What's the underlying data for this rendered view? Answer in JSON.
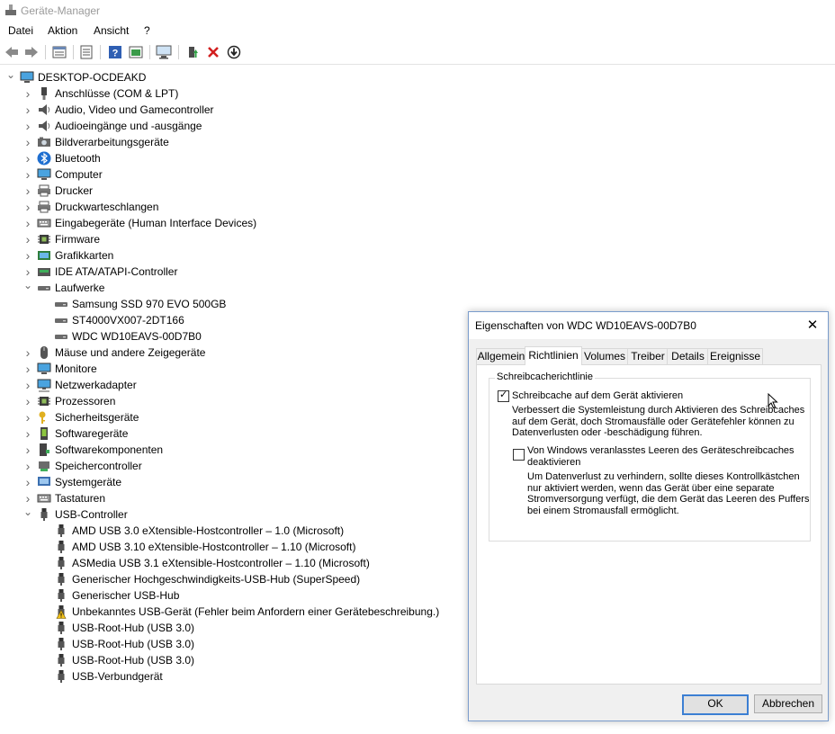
{
  "window": {
    "title": "Geräte-Manager"
  },
  "menu": [
    "Datei",
    "Aktion",
    "Ansicht",
    "?"
  ],
  "toolbar": {
    "icons": [
      "back-arrow-icon",
      "forward-arrow-icon",
      "properties-view-icon",
      "show-hidden-icon",
      "help-icon",
      "console-icon",
      "scan-hardware-icon",
      "enable-device-icon",
      "uninstall-device-icon",
      "update-driver-icon"
    ]
  },
  "tree": {
    "root": "DESKTOP-OCDEAKD",
    "categories": [
      {
        "label": "Anschlüsse (COM & LPT)",
        "icon": "port-icon",
        "expanded": false
      },
      {
        "label": "Audio, Video und Gamecontroller",
        "icon": "speaker-icon",
        "expanded": false
      },
      {
        "label": "Audioeingänge und -ausgänge",
        "icon": "speaker-icon",
        "expanded": false
      },
      {
        "label": "Bildverarbeitungsgeräte",
        "icon": "camera-icon",
        "expanded": false
      },
      {
        "label": "Bluetooth",
        "icon": "bluetooth-icon",
        "expanded": false
      },
      {
        "label": "Computer",
        "icon": "monitor-icon",
        "expanded": false
      },
      {
        "label": "Drucker",
        "icon": "printer-icon",
        "expanded": false
      },
      {
        "label": "Druckwarteschlangen",
        "icon": "printer-icon",
        "expanded": false
      },
      {
        "label": "Eingabegeräte (Human Interface Devices)",
        "icon": "keyboard-icon",
        "expanded": false
      },
      {
        "label": "Firmware",
        "icon": "chip-icon",
        "expanded": false
      },
      {
        "label": "Grafikkarten",
        "icon": "display-adapter-icon",
        "expanded": false
      },
      {
        "label": "IDE ATA/ATAPI-Controller",
        "icon": "ide-controller-icon",
        "expanded": false
      },
      {
        "label": "Laufwerke",
        "icon": "drive-icon",
        "expanded": true,
        "children": [
          "Samsung SSD 970 EVO 500GB",
          "ST4000VX007-2DT166",
          "WDC WD10EAVS-00D7B0"
        ]
      },
      {
        "label": "Mäuse und andere Zeigegeräte",
        "icon": "mouse-icon",
        "expanded": false
      },
      {
        "label": "Monitore",
        "icon": "monitor-icon",
        "expanded": false
      },
      {
        "label": "Netzwerkadapter",
        "icon": "network-icon",
        "expanded": false
      },
      {
        "label": "Prozessoren",
        "icon": "chip-icon",
        "expanded": false
      },
      {
        "label": "Sicherheitsgeräte",
        "icon": "key-icon",
        "expanded": false
      },
      {
        "label": "Softwaregeräte",
        "icon": "software-device-icon",
        "expanded": false
      },
      {
        "label": "Softwarekomponenten",
        "icon": "software-component-icon",
        "expanded": false
      },
      {
        "label": "Speichercontroller",
        "icon": "storage-controller-icon",
        "expanded": false
      },
      {
        "label": "Systemgeräte",
        "icon": "system-device-icon",
        "expanded": false
      },
      {
        "label": "Tastaturen",
        "icon": "keyboard-icon",
        "expanded": false
      },
      {
        "label": "USB-Controller",
        "icon": "usb-icon",
        "expanded": true,
        "children": [
          "AMD USB 3.0 eXtensible-Hostcontroller – 1.0 (Microsoft)",
          "AMD USB 3.10 eXtensible-Hostcontroller – 1.10 (Microsoft)",
          "ASMedia USB 3.1 eXtensible-Hostcontroller – 1.10 (Microsoft)",
          "Generischer Hochgeschwindigkeits-USB-Hub (SuperSpeed)",
          "Generischer USB-Hub",
          "Unbekanntes USB-Gerät (Fehler beim Anfordern einer Gerätebeschreibung.)",
          "USB-Root-Hub (USB 3.0)",
          "USB-Root-Hub (USB 3.0)",
          "USB-Root-Hub (USB 3.0)",
          "USB-Verbundgerät"
        ],
        "warning_child": 5
      }
    ]
  },
  "dialog": {
    "title": "Eigenschaften von WDC WD10EAVS-00D7B0",
    "close": "✕",
    "tabs": [
      "Allgemein",
      "Richtlinien",
      "Volumes",
      "Treiber",
      "Details",
      "Ereignisse"
    ],
    "active_tab": 1,
    "group_title": "Schreibcacherichtlinie",
    "option1": {
      "label": "Schreibcache auf dem Gerät aktivieren",
      "checked": true,
      "description": [
        "Verbessert die Systemleistung durch Aktivieren des Schreibcaches",
        "auf dem Gerät, doch Stromausfälle oder Gerätefehler können zu",
        "Datenverlusten oder -beschädigung führen."
      ]
    },
    "option2": {
      "label": [
        "Von Windows veranlasstes Leeren des Geräteschreibcaches",
        "deaktivieren"
      ],
      "checked": false,
      "description": [
        "Um Datenverlust zu verhindern, sollte dieses Kontrollkästchen",
        "nur aktiviert werden, wenn das Gerät über eine separate",
        "Stromversorgung verfügt, die dem Gerät das Leeren des Puffers",
        "bei einem Stromausfall ermöglicht."
      ]
    },
    "ok": "OK",
    "cancel": "Abbrechen"
  }
}
